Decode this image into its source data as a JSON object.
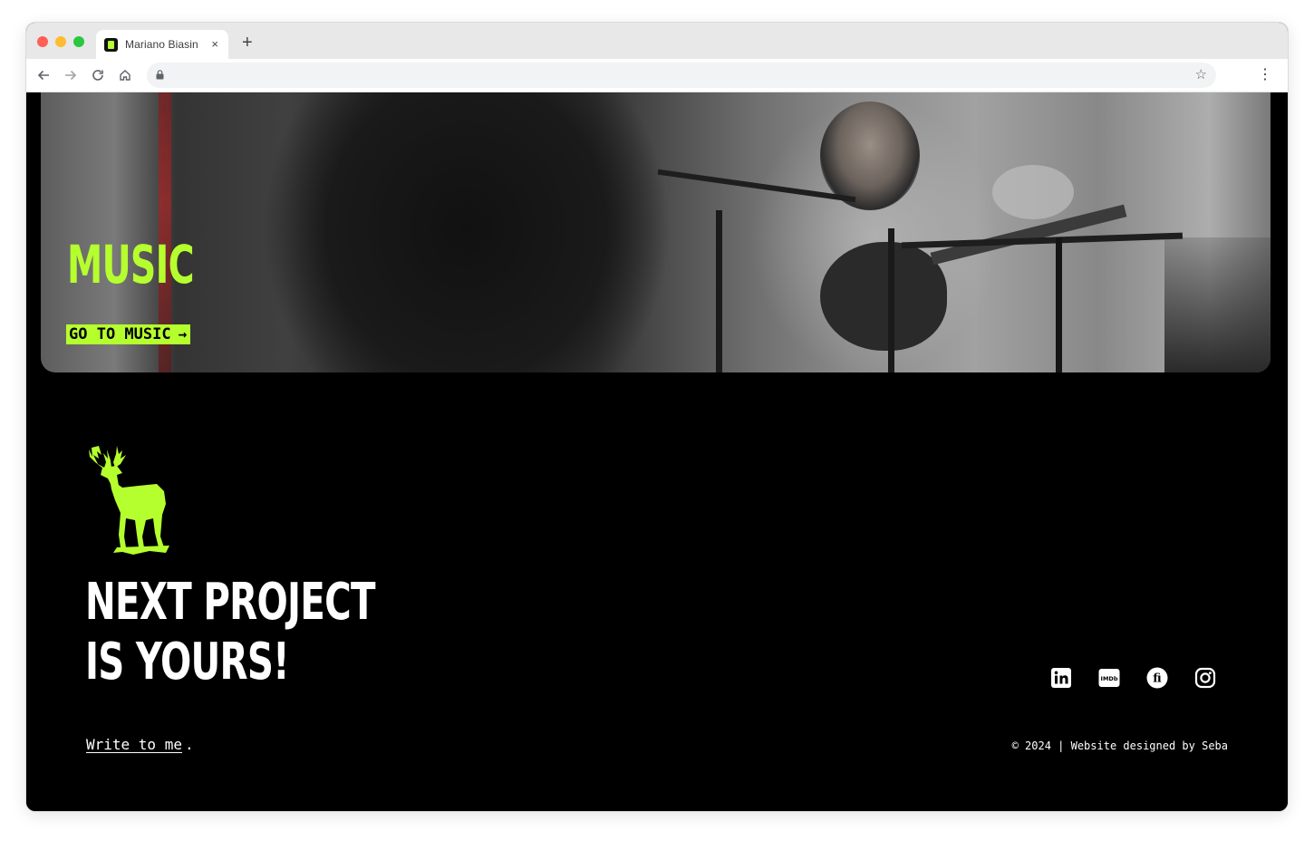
{
  "browser": {
    "tab_title": "Mariano Biasin",
    "tab_close": "×",
    "new_tab": "+",
    "back_icon": "arrow-left-icon",
    "forward_icon": "arrow-right-icon",
    "reload_icon": "reload-icon",
    "home_icon": "home-icon",
    "bookmark_icon": "star-icon",
    "menu_icon": "kebab-menu-icon"
  },
  "hero": {
    "title": "MUSIC",
    "cta_label": "GO TO MUSIC",
    "cta_arrow": "→",
    "accent_color": "#b6ff2e"
  },
  "footer": {
    "headline_line1": "NEXT PROJECT",
    "headline_line2": "IS YOURS!",
    "write_link": "Write to me",
    "write_period": ".",
    "copyright": "© 2024 | Website designed by Seba",
    "socials": [
      {
        "name": "linkedin-icon",
        "label": "in"
      },
      {
        "name": "imdb-icon",
        "label": "IMDb"
      },
      {
        "name": "filmaffinity-icon",
        "label": "fi"
      },
      {
        "name": "instagram-icon",
        "label": ""
      }
    ]
  }
}
